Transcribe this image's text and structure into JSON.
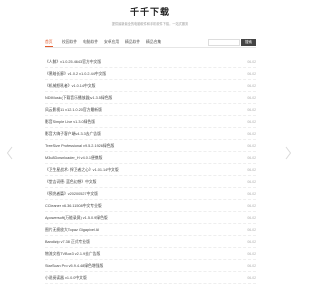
{
  "header": {
    "title": "千千下载",
    "subtitle": "提供最新最全的电脑软件和手机软件下载，一站式服务"
  },
  "nav": {
    "items": [
      {
        "label": "首页",
        "active": true
      },
      {
        "label": "校园软件",
        "active": false
      },
      {
        "label": "电脑软件",
        "active": false
      },
      {
        "label": "安卓应用",
        "active": false
      },
      {
        "label": "精品软件",
        "active": false
      },
      {
        "label": "精品合集",
        "active": false
      }
    ]
  },
  "search": {
    "placeholder": "",
    "button_label": "搜索"
  },
  "list": {
    "items": [
      {
        "title": "《人鲸》v1.0.25.4643官方中文版",
        "date": "06-02"
      },
      {
        "title": "《黑暗长廊》v1.0.2 v1.0.2.44中文版",
        "date": "06-02"
      },
      {
        "title": "《机械怒吼者》v1.0.14中文版",
        "date": "06-02"
      },
      {
        "title": "NDIMusic(下载音乐播放器)v1.3.5绿色版",
        "date": "06-02"
      },
      {
        "title": "风云影视11 v12.1.0.20官方最新版",
        "date": "06-02"
      },
      {
        "title": "影音Simple Live v1.3.0绿色版",
        "date": "06-02"
      },
      {
        "title": "影音大嗨子客户端v4.3.3去广告版",
        "date": "06-02"
      },
      {
        "title": "TreeSize Professional v9.5.2.1926绿色版",
        "date": "06-02"
      },
      {
        "title": "M3u8Downloader_H v4.0.1便携版",
        "date": "06-02"
      },
      {
        "title": "《卫生星战术: 捍卫者之心》v1.01.14中文版",
        "date": "06-02"
      },
      {
        "title": "《堂吉诃德: 蓝色幻想》中文版",
        "date": "06-02"
      },
      {
        "title": "《预兆者篇》v20200527中文版",
        "date": "06-02"
      },
      {
        "title": "CCleaner v6.36.11508中文专业版",
        "date": "06-02"
      },
      {
        "title": "Apowersoft(万能录屏) v1.5.0.9绿色版",
        "date": "06-02"
      },
      {
        "title": "图片无损放大Topaz Gigapixel AI",
        "date": "06-02"
      },
      {
        "title": "Bandizip v7.38 正式专业版",
        "date": "06-02"
      },
      {
        "title": "物流文档TVBox3 v2.1.9去广告版",
        "date": "06-02"
      },
      {
        "title": "StarScan Pro v5.9.4.48绿色增强版",
        "date": "06-02"
      },
      {
        "title": "小说阅读器 v1.0.0中文版",
        "date": "06-02"
      }
    ]
  },
  "icons": {
    "prev": "chevron-left-icon",
    "next": "chevron-right-icon"
  },
  "colors": {
    "accent": "#e25a2b",
    "search_button": "#444444"
  }
}
